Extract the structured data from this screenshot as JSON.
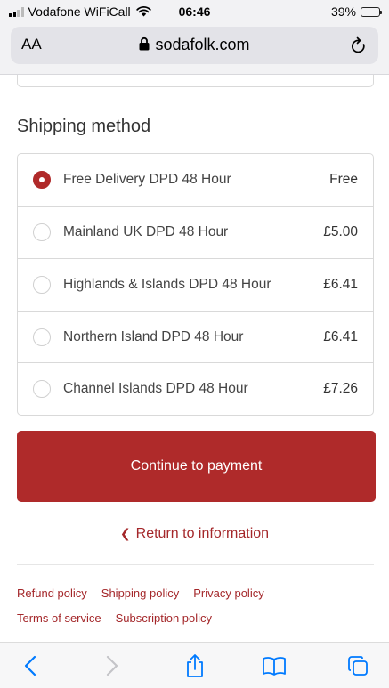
{
  "status_bar": {
    "carrier": "Vodafone WiFiCall",
    "time": "06:46",
    "battery_percent": "39%",
    "battery_level": 0.39
  },
  "address_bar": {
    "text_size_label": "AA",
    "url": "sodafolk.com"
  },
  "shipping": {
    "title": "Shipping method",
    "options": [
      {
        "label": "Free Delivery DPD 48 Hour",
        "price": "Free",
        "selected": true
      },
      {
        "label": "Mainland UK DPD 48 Hour",
        "price": "£5.00",
        "selected": false
      },
      {
        "label": "Highlands & Islands DPD 48 Hour",
        "price": "£6.41",
        "selected": false
      },
      {
        "label": "Northern Island DPD 48 Hour",
        "price": "£6.41",
        "selected": false
      },
      {
        "label": "Channel Islands DPD 48 Hour",
        "price": "£7.26",
        "selected": false
      }
    ]
  },
  "actions": {
    "continue_label": "Continue to payment",
    "return_label": "Return to information"
  },
  "footer": {
    "links": [
      "Refund policy",
      "Shipping policy",
      "Privacy policy",
      "Terms of service",
      "Subscription policy"
    ]
  },
  "toolbar": {
    "icons": [
      "back-icon",
      "forward-icon",
      "share-icon",
      "bookmarks-icon",
      "tabs-icon"
    ]
  },
  "colors": {
    "accent": "#af2a2a",
    "link": "#a4272a",
    "ios_blue": "#007aff"
  }
}
